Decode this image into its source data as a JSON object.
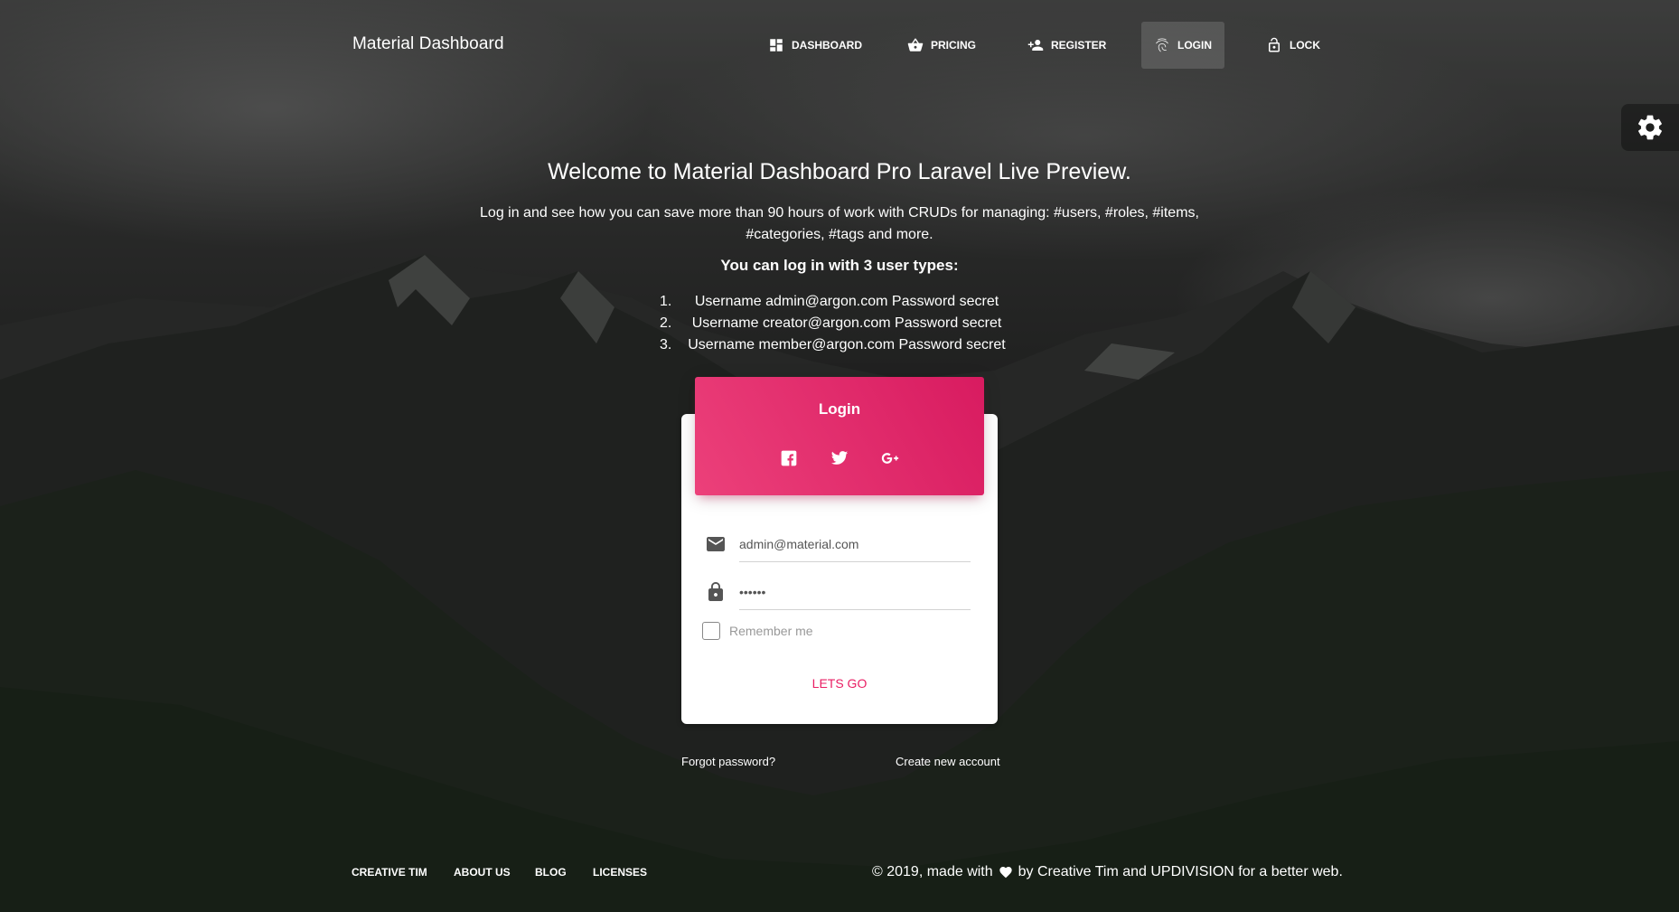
{
  "navbar": {
    "brand": "Material Dashboard",
    "items": [
      {
        "label": "Dashboard",
        "icon": "dashboard-icon"
      },
      {
        "label": "Pricing",
        "icon": "shopping-basket-icon"
      },
      {
        "label": "Register",
        "icon": "person-add-icon"
      },
      {
        "label": "Login",
        "icon": "fingerprint-icon",
        "active": true
      },
      {
        "label": "Lock",
        "icon": "lock-open-icon"
      }
    ]
  },
  "intro": {
    "title": "Welcome to Material Dashboard Pro Laravel Live Preview.",
    "description_line1": "Log in and see how you can save more than 90 hours of work with CRUDs for managing: #users, #roles, #items,",
    "description_line2": "#categories, #tags and more.",
    "subtitle": "You can log in with 3 user types:",
    "users": [
      {
        "num": "1.",
        "text": "Username admin@argon.com Password secret"
      },
      {
        "num": "2.",
        "text": "Username creator@argon.com Password secret"
      },
      {
        "num": "3.",
        "text": "Username member@argon.com Password secret"
      }
    ]
  },
  "login_card": {
    "title": "Login",
    "socials": [
      "facebook-icon",
      "twitter-icon",
      "google-plus-icon"
    ],
    "email_value": "admin@material.com",
    "password_value": "secret",
    "remember_label": "Remember me",
    "submit_label": "Lets Go"
  },
  "links": {
    "forgot": "Forgot password?",
    "create": "Create new account"
  },
  "footer": {
    "links": [
      "Creative Tim",
      "About Us",
      "Blog",
      "Licenses"
    ],
    "copyright_before": "© 2019, made with",
    "copyright_after": "by Creative Tim and UPDIVISION for a better web."
  },
  "colors": {
    "accent": "#e91e63",
    "header_gradient_start": "#ec407a",
    "header_gradient_end": "#d81b60"
  }
}
